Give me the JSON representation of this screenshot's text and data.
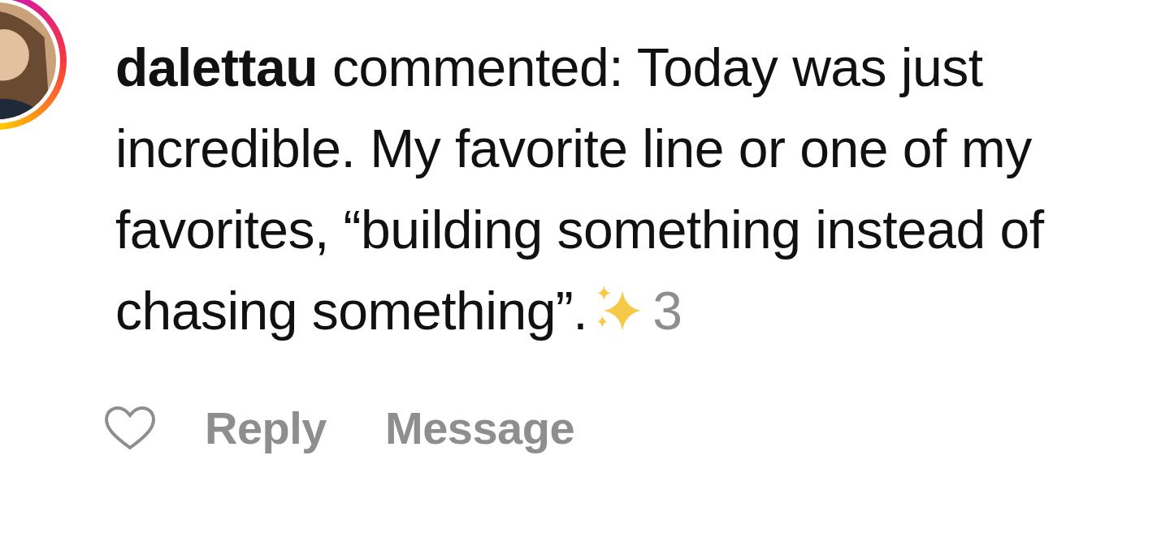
{
  "notification": {
    "avatar": {
      "story_ring": true
    },
    "username": "dalettau",
    "text": "commented: Today was just incredible. My favorite line or one of my favorites, “building something instead of chasing something”.",
    "time": "3"
  },
  "like": {
    "liked": false
  },
  "actions": [
    "Reply",
    "Message"
  ]
}
